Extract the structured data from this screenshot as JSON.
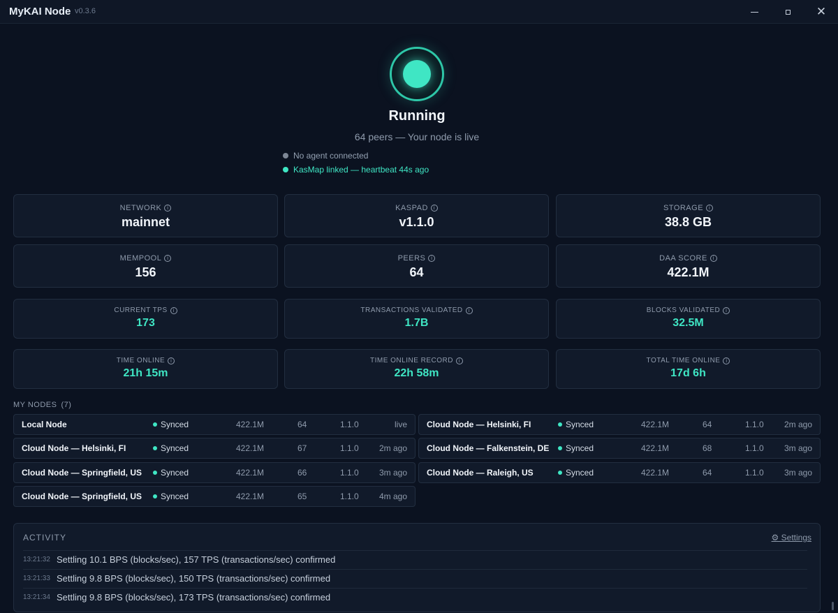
{
  "window": {
    "title": "MyKAI Node",
    "version": "v0.3.6",
    "minimize_icon": "minimize-icon",
    "maximize_icon": "maximize-icon",
    "close_icon": "close-icon"
  },
  "status": {
    "title": "Running",
    "subtitle": "64 peers — Your node is live",
    "agent_status": "No agent connected",
    "kasmap_status": "KasMap linked — heartbeat 44s ago",
    "accent_color": "#3fe6c4"
  },
  "info_icon_glyph": "i",
  "stats": [
    {
      "label": "NETWORK",
      "value": "mainnet"
    },
    {
      "label": "KASPAD",
      "value": "v1.1.0"
    },
    {
      "label": "STORAGE",
      "value": "38.8 GB"
    },
    {
      "label": "MEMPOOL",
      "value": "156"
    },
    {
      "label": "PEERS",
      "value": "64"
    },
    {
      "label": "DAA SCORE",
      "value": "422.1M"
    }
  ],
  "counters": [
    {
      "label": "CURRENT TPS",
      "value": "173"
    },
    {
      "label": "TRANSACTIONS VALIDATED",
      "value": "1.7B"
    },
    {
      "label": "BLOCKS VALIDATED",
      "value": "32.5M"
    },
    {
      "label": "TIME ONLINE",
      "value": "21h 15m"
    },
    {
      "label": "TIME ONLINE RECORD",
      "value": "22h 58m"
    },
    {
      "label": "TOTAL TIME ONLINE",
      "value": "17d 6h"
    }
  ],
  "my_nodes": {
    "label": "MY NODES",
    "count": "(7)",
    "rows": [
      {
        "name": "Local Node",
        "status": "Synced",
        "daa": "422.1M",
        "peers": "64",
        "version": "1.1.0",
        "seen": "live"
      },
      {
        "name": "Cloud Node — Helsinki, FI",
        "status": "Synced",
        "daa": "422.1M",
        "peers": "64",
        "version": "1.1.0",
        "seen": "2m ago"
      },
      {
        "name": "Cloud Node — Helsinki, FI",
        "status": "Synced",
        "daa": "422.1M",
        "peers": "67",
        "version": "1.1.0",
        "seen": "2m ago"
      },
      {
        "name": "Cloud Node — Falkenstein, DE",
        "status": "Synced",
        "daa": "422.1M",
        "peers": "68",
        "version": "1.1.0",
        "seen": "3m ago"
      },
      {
        "name": "Cloud Node — Springfield, US",
        "status": "Synced",
        "daa": "422.1M",
        "peers": "66",
        "version": "1.1.0",
        "seen": "3m ago"
      },
      {
        "name": "Cloud Node — Raleigh, US",
        "status": "Synced",
        "daa": "422.1M",
        "peers": "64",
        "version": "1.1.0",
        "seen": "3m ago"
      },
      {
        "name": "Cloud Node — Springfield, US",
        "status": "Synced",
        "daa": "422.1M",
        "peers": "65",
        "version": "1.1.0",
        "seen": "4m ago"
      }
    ]
  },
  "activity": {
    "title": "ACTIVITY",
    "settings_label": "⚙ Settings",
    "entries": [
      {
        "time": "13:21:32",
        "message": "Settling 10.1 BPS (blocks/sec), 157 TPS (transactions/sec) confirmed"
      },
      {
        "time": "13:21:33",
        "message": "Settling 9.8 BPS (blocks/sec), 150 TPS (transactions/sec) confirmed"
      },
      {
        "time": "13:21:34",
        "message": "Settling 9.8 BPS (blocks/sec), 173 TPS (transactions/sec) confirmed"
      }
    ]
  }
}
